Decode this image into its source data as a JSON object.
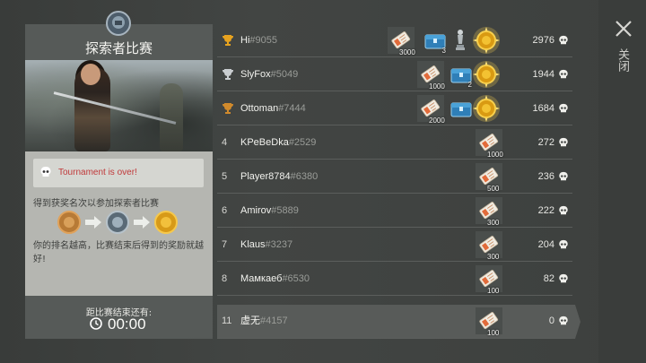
{
  "left_panel": {
    "title": "探索者比赛",
    "status_text": "Tournament is over!",
    "desc_top": "得到获奖名次以参加探索者比赛",
    "desc_bottom": "你的排名越高，比赛结束后得到的奖励就越好!",
    "footer_label": "距比赛结束还有:",
    "timer": "00:00"
  },
  "close": {
    "label": "关闭"
  },
  "leaderboard": [
    {
      "rank": "",
      "trophy": "gold",
      "name": "Hi",
      "id": "#9055",
      "score": "2976",
      "rewards": {
        "ticket_qty": "3000",
        "chest_qty": "3",
        "statuette": true,
        "medal": "gold"
      }
    },
    {
      "rank": "",
      "trophy": "silver",
      "name": "SlyFox",
      "id": "#5049",
      "score": "1944",
      "rewards": {
        "ticket_qty": "1000",
        "chest_qty": "2",
        "statuette": false,
        "medal": "gold"
      }
    },
    {
      "rank": "",
      "trophy": "bronze",
      "name": "Ottoman",
      "id": "#7444",
      "score": "1684",
      "rewards": {
        "ticket_qty": "2000",
        "chest_qty": "",
        "statuette": false,
        "medal": "gold"
      }
    },
    {
      "rank": "4",
      "trophy": "",
      "name": "KPeBeDka",
      "id": "#2529",
      "score": "272",
      "rewards": {
        "ticket_qty": "1000"
      }
    },
    {
      "rank": "5",
      "trophy": "",
      "name": "Player8784",
      "id": "#6380",
      "score": "236",
      "rewards": {
        "ticket_qty": "500"
      }
    },
    {
      "rank": "6",
      "trophy": "",
      "name": "Amirov",
      "id": "#5889",
      "score": "222",
      "rewards": {
        "ticket_qty": "300"
      }
    },
    {
      "rank": "7",
      "trophy": "",
      "name": "Klaus",
      "id": "#3237",
      "score": "204",
      "rewards": {
        "ticket_qty": "300"
      }
    },
    {
      "rank": "8",
      "trophy": "",
      "name": "Мамкаеб",
      "id": "#6530",
      "score": "82",
      "rewards": {
        "ticket_qty": "100"
      }
    }
  ],
  "me": {
    "rank": "11",
    "name": "虚无",
    "id": "#4157",
    "score": "0",
    "ticket_qty": "100"
  },
  "colors": {
    "gold": "#e6a21f",
    "silver": "#c9cdd0",
    "bronze": "#d08a2c",
    "status_red": "#c0393a"
  }
}
